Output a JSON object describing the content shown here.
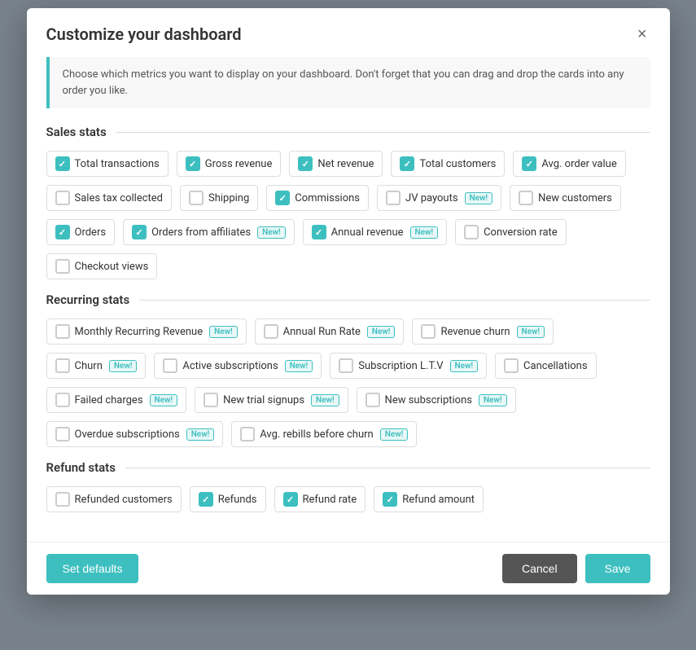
{
  "modal": {
    "title": "Customize your dashboard",
    "close_label": "×",
    "info_text": "Choose which metrics you want to display on your dashboard. Don't forget that you can drag and drop the cards into any order you like."
  },
  "sections": [
    {
      "id": "sales-stats",
      "title": "Sales stats",
      "items": [
        {
          "id": "total-transactions",
          "label": "Total transactions",
          "checked": true,
          "new": false
        },
        {
          "id": "gross-revenue",
          "label": "Gross revenue",
          "checked": true,
          "new": false
        },
        {
          "id": "net-revenue",
          "label": "Net revenue",
          "checked": true,
          "new": false
        },
        {
          "id": "total-customers",
          "label": "Total customers",
          "checked": true,
          "new": false
        },
        {
          "id": "avg-order-value",
          "label": "Avg. order value",
          "checked": true,
          "new": false
        },
        {
          "id": "sales-tax-collected",
          "label": "Sales tax collected",
          "checked": false,
          "new": false
        },
        {
          "id": "shipping",
          "label": "Shipping",
          "checked": false,
          "new": false
        },
        {
          "id": "commissions",
          "label": "Commissions",
          "checked": true,
          "new": false
        },
        {
          "id": "jv-payouts",
          "label": "JV payouts",
          "checked": false,
          "new": true
        },
        {
          "id": "new-customers",
          "label": "New customers",
          "checked": false,
          "new": false
        },
        {
          "id": "orders",
          "label": "Orders",
          "checked": true,
          "new": false
        },
        {
          "id": "orders-from-affiliates",
          "label": "Orders from affiliates",
          "checked": true,
          "new": true
        },
        {
          "id": "annual-revenue",
          "label": "Annual revenue",
          "checked": true,
          "new": true
        },
        {
          "id": "conversion-rate",
          "label": "Conversion rate",
          "checked": false,
          "new": false
        },
        {
          "id": "checkout-views",
          "label": "Checkout views",
          "checked": false,
          "new": false
        }
      ]
    },
    {
      "id": "recurring-stats",
      "title": "Recurring stats",
      "items": [
        {
          "id": "monthly-recurring-revenue",
          "label": "Monthly Recurring Revenue",
          "checked": false,
          "new": true
        },
        {
          "id": "annual-run-rate",
          "label": "Annual Run Rate",
          "checked": false,
          "new": true
        },
        {
          "id": "revenue-churn",
          "label": "Revenue churn",
          "checked": false,
          "new": true
        },
        {
          "id": "churn",
          "label": "Churn",
          "checked": false,
          "new": true
        },
        {
          "id": "active-subscriptions",
          "label": "Active subscriptions",
          "checked": false,
          "new": true
        },
        {
          "id": "subscription-ltv",
          "label": "Subscription L.T.V",
          "checked": false,
          "new": true
        },
        {
          "id": "cancellations",
          "label": "Cancellations",
          "checked": false,
          "new": false
        },
        {
          "id": "failed-charges",
          "label": "Failed charges",
          "checked": false,
          "new": true
        },
        {
          "id": "new-trial-signups",
          "label": "New trial signups",
          "checked": false,
          "new": true
        },
        {
          "id": "new-subscriptions",
          "label": "New subscriptions",
          "checked": false,
          "new": true
        },
        {
          "id": "overdue-subscriptions",
          "label": "Overdue subscriptions",
          "checked": false,
          "new": true
        },
        {
          "id": "avg-rebills-before-churn",
          "label": "Avg. rebills before churn",
          "checked": false,
          "new": true
        }
      ]
    },
    {
      "id": "refund-stats",
      "title": "Refund stats",
      "items": [
        {
          "id": "refunded-customers",
          "label": "Refunded customers",
          "checked": false,
          "new": false
        },
        {
          "id": "refunds",
          "label": "Refunds",
          "checked": true,
          "new": false
        },
        {
          "id": "refund-rate",
          "label": "Refund rate",
          "checked": true,
          "new": false
        },
        {
          "id": "refund-amount",
          "label": "Refund amount",
          "checked": true,
          "new": false
        }
      ]
    }
  ],
  "footer": {
    "set_defaults_label": "Set defaults",
    "cancel_label": "Cancel",
    "save_label": "Save"
  }
}
